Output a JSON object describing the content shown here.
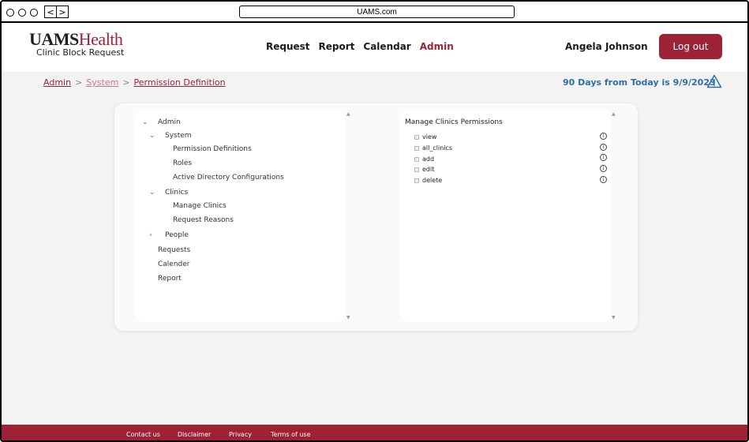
{
  "browser": {
    "url": "UAMS.com",
    "back": "<",
    "forward": ">"
  },
  "header": {
    "logo_primary": "UAMS",
    "logo_secondary": "Health",
    "logo_subtitle": "Clinic Block Request",
    "nav": [
      "Request",
      "Report",
      "Calendar",
      "Admin"
    ],
    "active_nav": "Admin",
    "user_name": "Angela Johnson",
    "logout_label": "Log out"
  },
  "breadcrumb": {
    "items": [
      "Admin",
      "System",
      "Permission Definition"
    ],
    "separator": ">"
  },
  "notice": "90 Days from Today is 9/9/2023",
  "tree": {
    "admin": "Admin",
    "system": "System",
    "permission_definitions": "Permission Definitions",
    "roles": "Roles",
    "active_directory": "Active Directory Configurations",
    "clinics": "Clinics",
    "manage_clinics": "Manage Clinics",
    "request_reasons": "Request Reasons",
    "people": "People",
    "requests": "Requests",
    "calender": "Calender",
    "report": "Report"
  },
  "permissions": {
    "title": "Manage Clinics Permissions",
    "items": [
      "view",
      "all_clinics",
      "add",
      "edit",
      "delete"
    ]
  },
  "footer": {
    "links": [
      "Contact us",
      "Disclaimer",
      "Privacy",
      "Terms of use"
    ]
  },
  "colors": {
    "brand": "#9d2235",
    "notice": "#2f6fa7"
  }
}
